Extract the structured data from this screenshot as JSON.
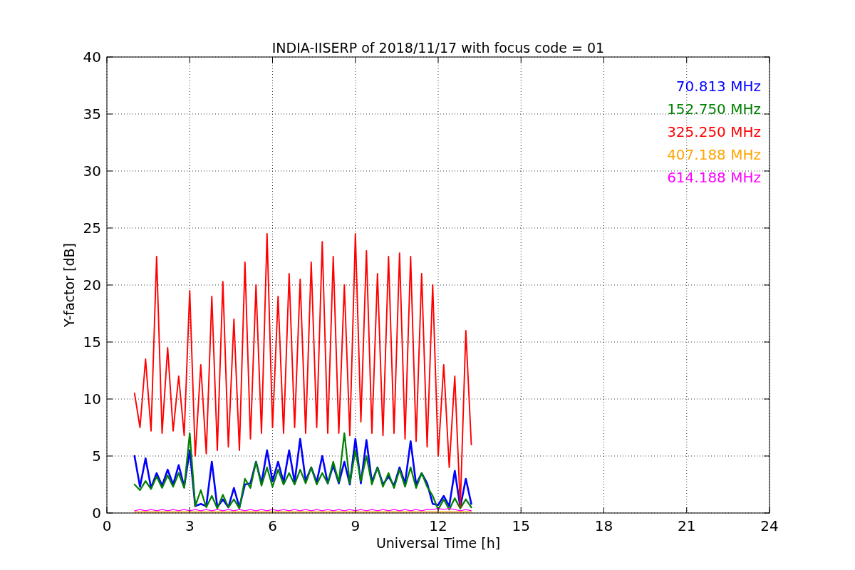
{
  "chart_data": {
    "type": "line",
    "title": "INDIA-IISERP of 2018/11/17 with focus code = 01",
    "xlabel": "Universal Time [h]",
    "ylabel": "Y-factor [dB]",
    "xlim": [
      0,
      24
    ],
    "ylim": [
      0,
      40
    ],
    "grid": true,
    "xticks": [
      0,
      3,
      6,
      9,
      12,
      15,
      18,
      21,
      24
    ],
    "yticks": [
      0,
      5,
      10,
      15,
      20,
      25,
      30,
      35,
      40
    ],
    "x": [
      1.0,
      1.2,
      1.4,
      1.6,
      1.8,
      2.0,
      2.2,
      2.4,
      2.6,
      2.8,
      3.0,
      3.2,
      3.4,
      3.6,
      3.8,
      4.0,
      4.2,
      4.4,
      4.6,
      4.8,
      5.0,
      5.2,
      5.4,
      5.6,
      5.8,
      6.0,
      6.2,
      6.4,
      6.6,
      6.8,
      7.0,
      7.2,
      7.4,
      7.6,
      7.8,
      8.0,
      8.2,
      8.4,
      8.6,
      8.8,
      9.0,
      9.2,
      9.4,
      9.6,
      9.8,
      10.0,
      10.2,
      10.4,
      10.6,
      10.8,
      11.0,
      11.2,
      11.4,
      11.6,
      11.8,
      12.0,
      12.2,
      12.4,
      12.6,
      12.8,
      13.0,
      13.2
    ],
    "series": [
      {
        "name": "70.813 MHz",
        "color": "#0000ff",
        "values": [
          5,
          2.3,
          4.8,
          2.2,
          3.5,
          2.4,
          3.8,
          2.5,
          4.2,
          2.3,
          5.5,
          0.6,
          0.8,
          0.6,
          4.5,
          0.5,
          1.2,
          0.5,
          2.2,
          0.5,
          2.5,
          2.6,
          4.5,
          2.6,
          5.5,
          2.8,
          4.5,
          2.7,
          5.5,
          2.7,
          6.5,
          2.8,
          4.0,
          2.7,
          5.0,
          2.6,
          4.2,
          2.6,
          4.5,
          2.5,
          6.5,
          2.6,
          6.4,
          2.7,
          4.0,
          2.5,
          3.2,
          2.4,
          4.0,
          2.6,
          6.3,
          2.5,
          3.5,
          2.6,
          0.8,
          0.7,
          1.5,
          0.6,
          3.7,
          0.5,
          3.0,
          0.8
        ]
      },
      {
        "name": "152.750 MHz",
        "color": "#008000",
        "values": [
          2.5,
          2.0,
          2.8,
          2.1,
          3.2,
          2.2,
          3.3,
          2.3,
          3.5,
          2.2,
          7.0,
          0.6,
          2.0,
          0.5,
          1.5,
          0.4,
          1.6,
          0.5,
          1.2,
          0.4,
          3.0,
          2.2,
          4.5,
          2.4,
          4.0,
          2.3,
          3.8,
          2.5,
          3.5,
          2.5,
          3.8,
          2.6,
          4.0,
          2.5,
          3.5,
          2.6,
          4.5,
          2.7,
          7.0,
          2.6,
          5.5,
          2.8,
          5.0,
          2.5,
          4.0,
          2.3,
          3.5,
          2.2,
          3.8,
          2.3,
          4.0,
          2.2,
          3.5,
          2.3,
          1.5,
          0.3,
          1.2,
          0.3,
          1.3,
          0.4,
          1.2,
          0.5
        ]
      },
      {
        "name": "325.250 MHz",
        "color": "#ff0000",
        "values": [
          10.5,
          7.5,
          13.5,
          7.2,
          22.5,
          7.0,
          14.5,
          7.2,
          12,
          6.8,
          19.5,
          5.0,
          13,
          5.2,
          19,
          5.5,
          20.3,
          5.8,
          17,
          5.5,
          22,
          6.5,
          20,
          7.0,
          24.5,
          7.5,
          19,
          7.0,
          21,
          7.5,
          20.5,
          7.0,
          22,
          7.5,
          23.8,
          7.0,
          22.5,
          7.0,
          20,
          6.8,
          24.5,
          8,
          23,
          7.0,
          21,
          6.8,
          22.5,
          7.0,
          22.8,
          6.5,
          22.5,
          6.3,
          21,
          5.8,
          20,
          5.0,
          13,
          4.0,
          12,
          0.5,
          16,
          6
        ]
      },
      {
        "name": "407.188 MHz",
        "color": "#ffa500",
        "values": [
          0.1,
          0.1,
          0.1,
          0.1,
          0.1,
          0.1,
          0.1,
          0.1,
          0.1,
          0.1,
          0.1,
          0.1,
          0.1,
          0.1,
          0.1,
          0.1,
          0.1,
          0.1,
          0.1,
          0.1,
          0.1,
          0.1,
          0.1,
          0.1,
          0.1,
          0.1,
          0.1,
          0.1,
          0.1,
          0.1,
          0.1,
          0.1,
          0.1,
          0.1,
          0.1,
          0.1,
          0.1,
          0.1,
          0.1,
          0.1,
          0.1,
          0.1,
          0.1,
          0.1,
          0.1,
          0.1,
          0.1,
          0.1,
          0.1,
          0.1,
          0.1,
          0.1,
          0.1,
          0.1,
          0.1,
          0.1,
          0.1,
          0.1,
          0.1,
          0.1,
          0.1,
          0.1
        ]
      },
      {
        "name": "614.188 MHz",
        "color": "#ff00ff",
        "values": [
          0.2,
          0.3,
          0.2,
          0.3,
          0.2,
          0.3,
          0.2,
          0.3,
          0.2,
          0.3,
          0.2,
          0.3,
          0.2,
          0.3,
          0.2,
          0.3,
          0.2,
          0.3,
          0.2,
          0.3,
          0.2,
          0.3,
          0.2,
          0.3,
          0.2,
          0.3,
          0.2,
          0.3,
          0.2,
          0.3,
          0.2,
          0.3,
          0.2,
          0.3,
          0.2,
          0.3,
          0.2,
          0.3,
          0.2,
          0.3,
          0.2,
          0.3,
          0.2,
          0.3,
          0.2,
          0.3,
          0.2,
          0.3,
          0.2,
          0.3,
          0.2,
          0.3,
          0.2,
          0.3,
          0.3,
          0.4,
          0.3,
          0.4,
          0.3,
          0.2,
          0.3,
          0.2
        ]
      }
    ]
  }
}
